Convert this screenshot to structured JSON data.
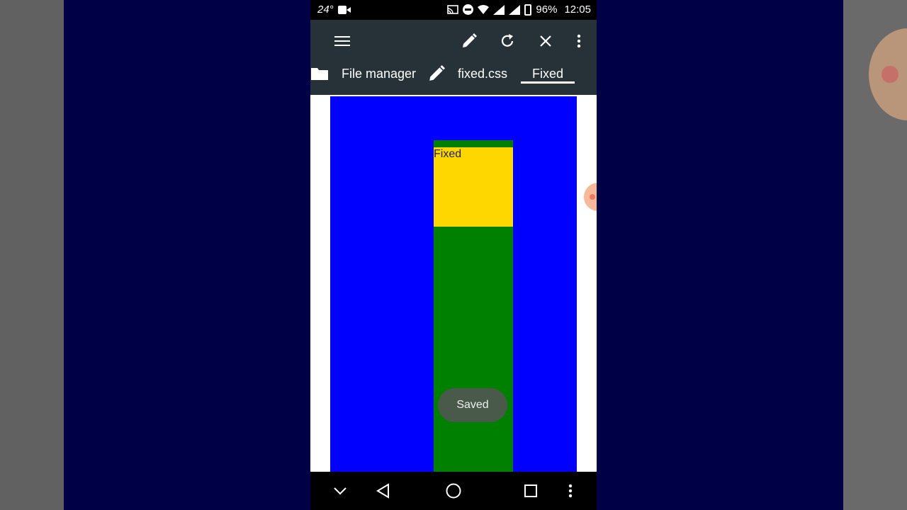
{
  "status_bar": {
    "temperature": "24°",
    "battery": "96%",
    "time": "12:05"
  },
  "toolbar": {
    "tabs": [
      {
        "label": "File manager"
      },
      {
        "label": "fixed.css"
      },
      {
        "label": "Fixed",
        "active": true
      }
    ]
  },
  "content": {
    "box_label": "Fixed",
    "colors": {
      "background": "#0000ff",
      "outer_box": "#008000",
      "inner_box": "#ffd700"
    }
  },
  "toast": {
    "message": "Saved"
  },
  "icons": [
    "menu-icon",
    "pencil-icon",
    "refresh-icon",
    "close-icon",
    "more-vert-icon",
    "folder-icon",
    "chevron-down-icon",
    "back-icon",
    "home-icon",
    "recent-apps-icon"
  ]
}
